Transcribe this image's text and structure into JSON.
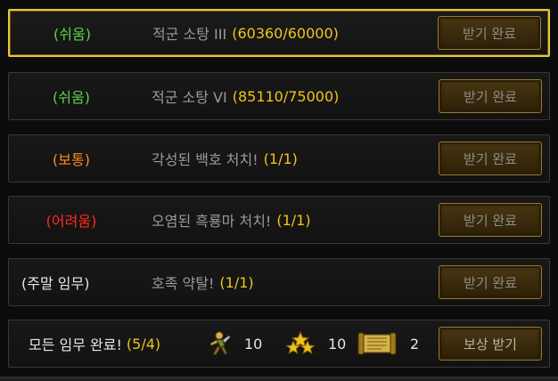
{
  "colors": {
    "easy": "#5fd34a",
    "normal": "#ff8a1c",
    "hard": "#ff2a1a",
    "weekend": "#e6e6e6",
    "progress": "#f0c419",
    "highlight_border": "#e8c63a"
  },
  "quests": [
    {
      "difficulty": "(쉬움)",
      "tier": "easy",
      "title": "적군 소탕 III",
      "progress": "(60360/60000)",
      "button": "받기 완료",
      "selected": true
    },
    {
      "difficulty": "(쉬움)",
      "tier": "easy",
      "title": "적군 소탕 VI",
      "progress": "(85110/75000)",
      "button": "받기 완료"
    },
    {
      "difficulty": "(보통)",
      "tier": "normal",
      "title": "각성된 백호 처치!",
      "progress": "(1/1)",
      "button": "받기 완료"
    },
    {
      "difficulty": "(어려움)",
      "tier": "hard",
      "title": "오염된 흑룡마 처치!",
      "progress": "(1/1)",
      "button": "받기 완료"
    },
    {
      "difficulty": "(주말 임무)",
      "tier": "weekend",
      "title": "호족 약탈!",
      "progress": "(1/1)",
      "button": "받기 완료"
    }
  ],
  "summary": {
    "label": "모든 임무 완료!",
    "progress": "(5/4)",
    "rewards": [
      {
        "icon": "soldier-icon",
        "count": "10"
      },
      {
        "icon": "stars-icon",
        "count": "10"
      },
      {
        "icon": "scroll-icon",
        "count": "2"
      }
    ],
    "button": "보상 받기"
  }
}
